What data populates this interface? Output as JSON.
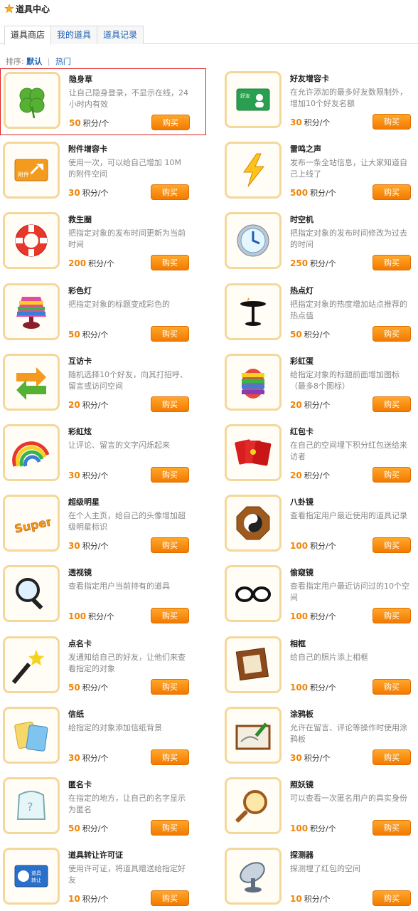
{
  "header": {
    "title": "道具中心"
  },
  "tabs": [
    {
      "label": "道具商店",
      "active": true
    },
    {
      "label": "我的道具",
      "active": false
    },
    {
      "label": "道具记录",
      "active": false
    }
  ],
  "sort": {
    "label": "排序:",
    "options": [
      "默认",
      "热门"
    ],
    "active": "默认"
  },
  "buy_label": "购买",
  "unit": "积分/个",
  "items": [
    {
      "name": "隐身草",
      "desc": "让自己隐身登录，不显示在线，24小时内有效",
      "price": "50",
      "icon": "clover-icon",
      "selected": true
    },
    {
      "name": "好友增容卡",
      "desc": "在允许添加的最多好友数限制外，增加10个好友名额",
      "price": "30",
      "icon": "friend-card-icon"
    },
    {
      "name": "附件增容卡",
      "desc": "使用一次，可以给自己增加 10M 的附件空间",
      "price": "30",
      "icon": "attachment-card-icon"
    },
    {
      "name": "雷鸣之声",
      "desc": "发布一条全站信息，让大家知道自己上线了",
      "price": "500",
      "icon": "lightning-icon"
    },
    {
      "name": "救生圈",
      "desc": "把指定对象的发布时间更新为当前时间",
      "price": "200",
      "icon": "lifebuoy-icon"
    },
    {
      "name": "时空机",
      "desc": "把指定对象的发布时间修改为过去的时间",
      "price": "250",
      "icon": "clock-icon"
    },
    {
      "name": "彩色灯",
      "desc": "把指定对象的标题变成彩色的",
      "price": "50",
      "icon": "rainbow-lamp-icon"
    },
    {
      "name": "热点灯",
      "desc": "把指定对象的热度增加站点推荐的热点值",
      "price": "50",
      "icon": "hot-lamp-icon"
    },
    {
      "name": "互访卡",
      "desc": "随机选择10个好友，向其打招呼、留言或访问空间",
      "price": "20",
      "icon": "arrows-icon"
    },
    {
      "name": "彩虹蛋",
      "desc": "给指定对象的标题前面增加图标（最多8个图标）",
      "price": "20",
      "icon": "rainbow-egg-icon"
    },
    {
      "name": "彩虹炫",
      "desc": "让评论、留言的文字闪烁起来",
      "price": "30",
      "icon": "rainbow-icon"
    },
    {
      "name": "红包卡",
      "desc": "在自己的空间埋下积分红包送给来访者",
      "price": "20",
      "icon": "red-envelope-icon"
    },
    {
      "name": "超级明星",
      "desc": "在个人主页，给自己的头像增加超级明星标识",
      "price": "30",
      "icon": "super-star-icon"
    },
    {
      "name": "八卦镜",
      "desc": "查看指定用户最近使用的道具记录",
      "price": "100",
      "icon": "bagua-mirror-icon"
    },
    {
      "name": "透视镜",
      "desc": "查看指定用户当前持有的道具",
      "price": "100",
      "icon": "magnifier-icon"
    },
    {
      "name": "偷窥镜",
      "desc": "查看指定用户最近访问过的10个空间",
      "price": "100",
      "icon": "glasses-icon"
    },
    {
      "name": "点名卡",
      "desc": "发通知给自己的好友，让他们来查看指定的对象",
      "price": "50",
      "icon": "magic-wand-icon"
    },
    {
      "name": "相框",
      "desc": "给自己的照片添上相框",
      "price": "100",
      "icon": "photo-frame-icon"
    },
    {
      "name": "信纸",
      "desc": "给指定的对象添加信纸背景",
      "price": "30",
      "icon": "letter-paper-icon"
    },
    {
      "name": "涂鸦板",
      "desc": "允许在留言、评论等操作时使用涂鸦板",
      "price": "30",
      "icon": "drawing-board-icon"
    },
    {
      "name": "匿名卡",
      "desc": "在指定的地方，让自己的名字显示为匿名",
      "price": "50",
      "icon": "anonymous-icon"
    },
    {
      "name": "照妖镜",
      "desc": "可以查看一次匿名用户的真实身份",
      "price": "100",
      "icon": "hand-mirror-icon"
    },
    {
      "name": "道具转让许可证",
      "desc": "使用许可证，将道具赠送给指定好友",
      "price": "10",
      "icon": "transfer-card-icon"
    },
    {
      "name": "探测器",
      "desc": "探测埋了红包的空间",
      "price": "10",
      "icon": "radar-dish-icon"
    }
  ]
}
